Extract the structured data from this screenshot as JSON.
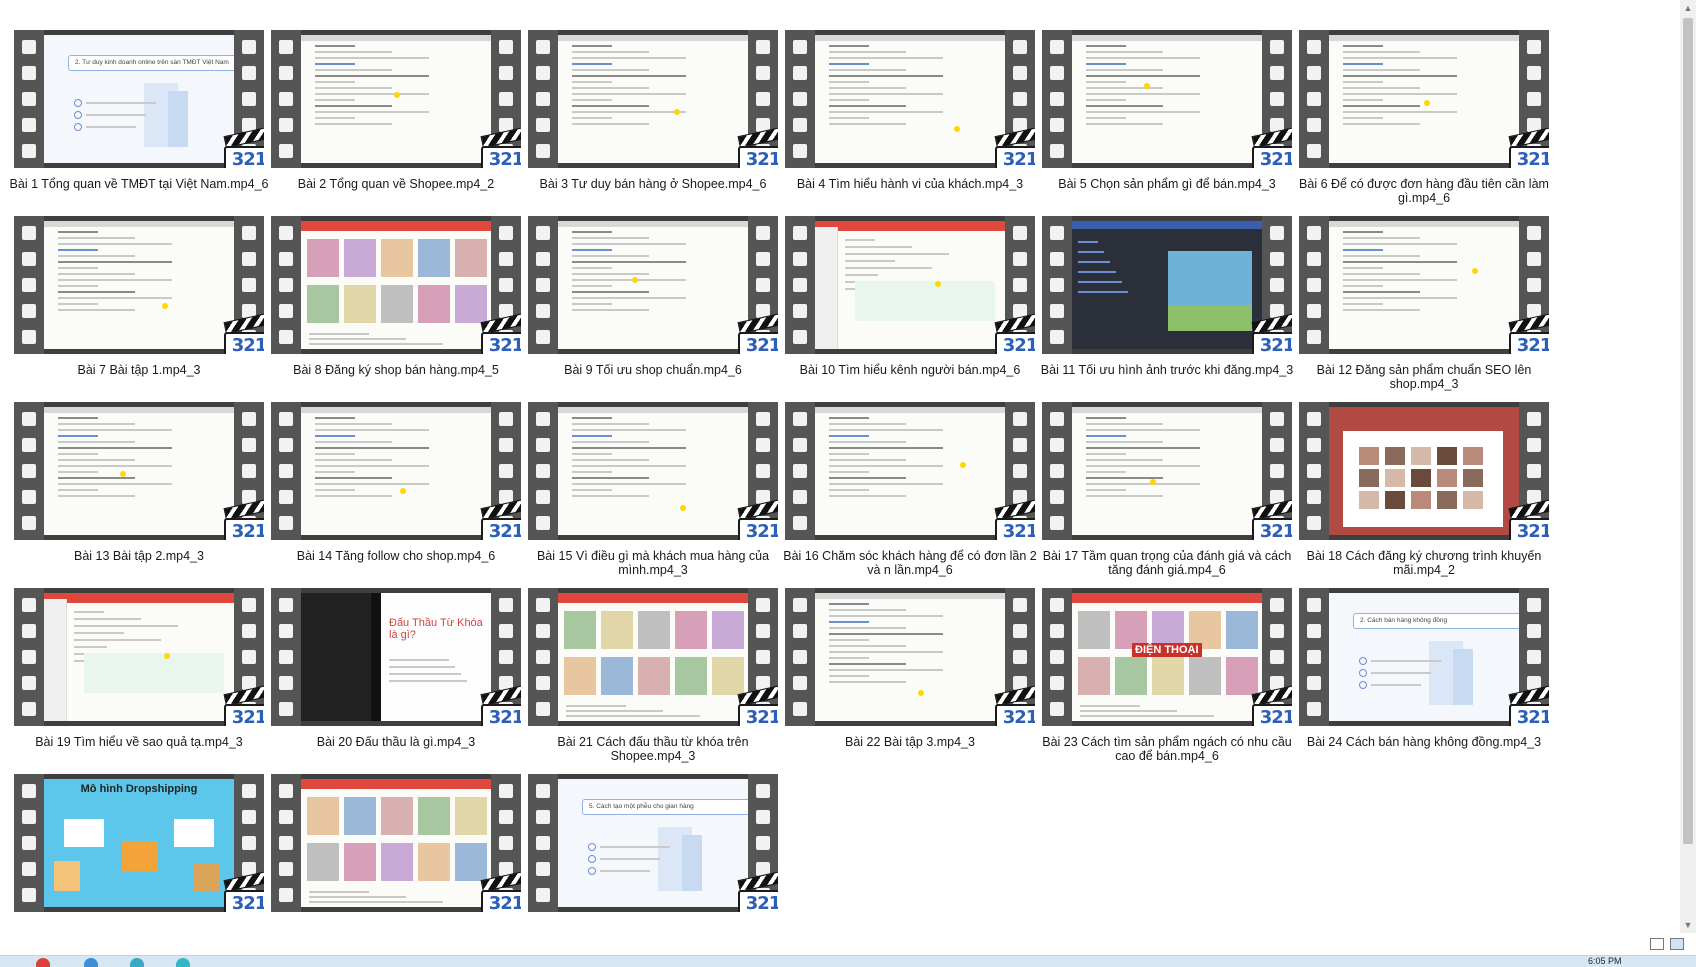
{
  "videos": [
    {
      "title": "Bài 1 Tổng quan về TMĐT tại Việt Nam.mp4_6",
      "style": "slide",
      "slide_text": "2. Tư duy kinh doanh online trên sàn TMĐT Việt Nam"
    },
    {
      "title": "Bài 2 Tổng quan về Shopee.mp4_2",
      "style": "doc"
    },
    {
      "title": "Bài 3 Tư duy bán hàng ở Shopee.mp4_6",
      "style": "doc"
    },
    {
      "title": "Bài 4 Tìm hiểu hành vi của khách.mp4_3",
      "style": "doc"
    },
    {
      "title": "Bài 5 Chọn sản phẩm gì để bán.mp4_3",
      "style": "doc"
    },
    {
      "title": "Bài 6 Để có được đơn hàng đầu tiên cần làm gì.mp4_6",
      "style": "doc"
    },
    {
      "title": "Bài 7 Bài tập 1.mp4_3",
      "style": "doc"
    },
    {
      "title": "Bài 8 Đăng ký shop bán hàng.mp4_5",
      "style": "shop"
    },
    {
      "title": "Bài 9 Tối ưu shop chuẩn.mp4_6",
      "style": "doc"
    },
    {
      "title": "Bài 10 Tìm hiểu kênh người bán.mp4_6",
      "style": "seller"
    },
    {
      "title": "Bài 11 Tối ưu hình ảnh trước khi đăng.mp4_3",
      "style": "design"
    },
    {
      "title": "Bài 12 Đăng sản phẩm chuẩn SEO lên shop.mp4_3",
      "style": "doc"
    },
    {
      "title": "Bài 13 Bài tập 2.mp4_3",
      "style": "doc"
    },
    {
      "title": "Bài 14 Tăng follow cho shop.mp4_6",
      "style": "doc"
    },
    {
      "title": "Bài 15 Vì điều gì mà khách mua hàng của mình.mp4_3",
      "style": "doc"
    },
    {
      "title": "Bài 16 Chăm sóc khách hàng để có đơn lần 2 và n lần.mp4_6",
      "style": "doc"
    },
    {
      "title": "Bài 17 Tầm quan trọng của đánh giá và cách tăng đánh giá.mp4_6",
      "style": "doc"
    },
    {
      "title": "Bài 18 Cách đăng ký chương trình khuyến mãi.mp4_2",
      "style": "promo"
    },
    {
      "title": "Bài 19 Tìm hiểu về sao quả tạ.mp4_3",
      "style": "seller"
    },
    {
      "title": "Bài 20 Đấu thầu là gì.mp4_3",
      "style": "bid",
      "slide_text": "Đấu Thầu Từ Khóa là gì?"
    },
    {
      "title": "Bài 21 Cách đấu thầu từ khóa trên Shopee.mp4_3",
      "style": "shop"
    },
    {
      "title": "Bài 22  Bài tập 3.mp4_3",
      "style": "doc"
    },
    {
      "title": "Bài 23 Cách tìm sản phẩm ngách có nhu cầu cao để bán.mp4_6",
      "style": "shop",
      "slide_text": "ĐIỆN THOẠI"
    },
    {
      "title": "Bài 24 Cách bán hàng không đồng.mp4_3",
      "style": "slide",
      "slide_text": "2. Cách bán hàng không đồng"
    },
    {
      "title": "",
      "style": "drop",
      "slide_text": "Mô hình Dropshipping"
    },
    {
      "title": "",
      "style": "shop"
    },
    {
      "title": "",
      "style": "slide",
      "slide_text": "5. Cách tạo một phễu cho gian hàng"
    }
  ],
  "badge_text": "321",
  "taskbar": {
    "clock": "6:05 PM"
  },
  "colors": {
    "accent_blue": "#2c5fb7",
    "shopee_red": "#e0473d",
    "film_gray": "#555555"
  }
}
